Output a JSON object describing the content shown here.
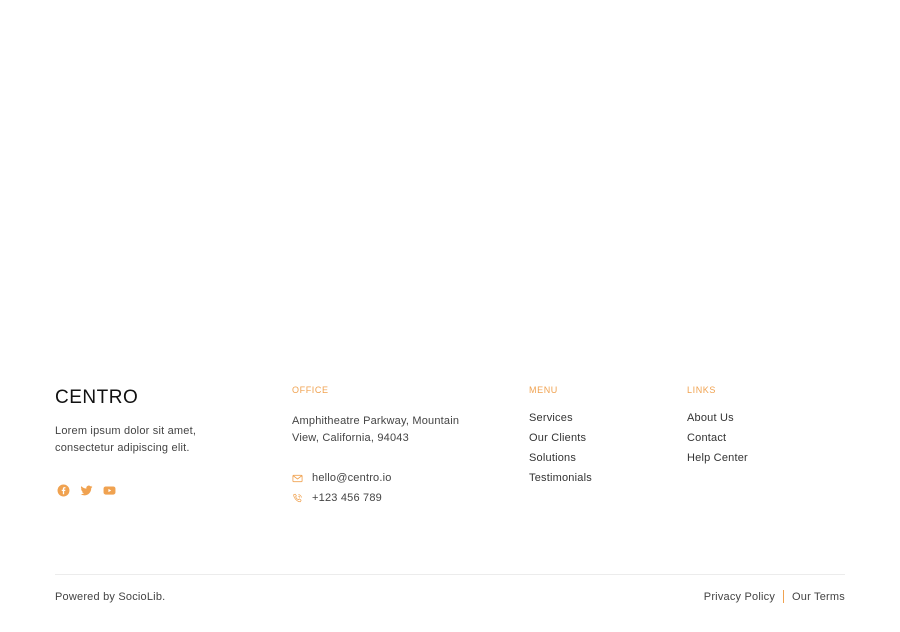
{
  "brand": {
    "name": "CENTRO",
    "description": "Lorem ipsum dolor sit amet, consectetur adipiscing elit."
  },
  "social": {
    "color": "#f0a250",
    "items": [
      {
        "icon": "facebook-icon"
      },
      {
        "icon": "twitter-icon"
      },
      {
        "icon": "youtube-icon"
      }
    ]
  },
  "office": {
    "title": "OFFICE",
    "address": "Amphitheatre Parkway, Mountain View, California, 94043",
    "email": "hello@centro.io",
    "phone": "+123 456 789"
  },
  "menu": {
    "title": "MENU",
    "items": [
      "Services",
      "Our Clients",
      "Solutions",
      "Testimonials"
    ]
  },
  "links": {
    "title": "LINKS",
    "items": [
      "About Us",
      "Contact",
      "Help Center"
    ]
  },
  "bottom": {
    "powered": "Powered by SocioLib.",
    "privacy": "Privacy Policy",
    "terms": "Our Terms"
  },
  "colors": {
    "accent": "#f0a250",
    "text": "#444444",
    "heading": "#111111"
  }
}
